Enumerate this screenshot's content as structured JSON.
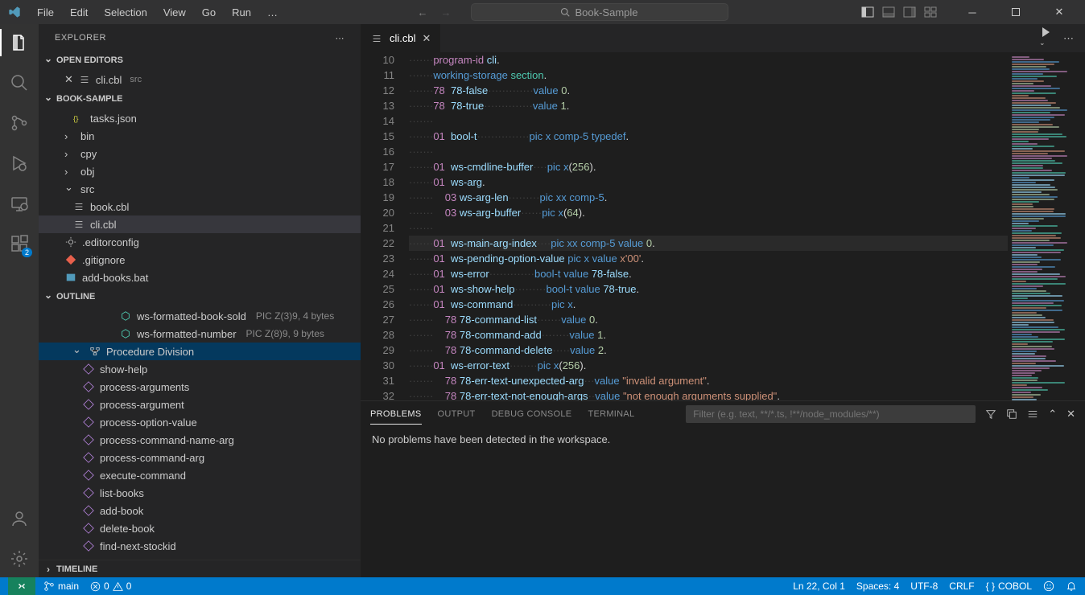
{
  "title": "Book-Sample",
  "menu": [
    "File",
    "Edit",
    "Selection",
    "View",
    "Go",
    "Run",
    "…"
  ],
  "explorer": {
    "title": "EXPLORER",
    "openEditors": {
      "label": "OPEN EDITORS",
      "items": [
        {
          "name": "cli.cbl",
          "dir": "src"
        }
      ]
    },
    "folder": {
      "label": "BOOK-SAMPLE",
      "items": [
        {
          "name": "tasks.json",
          "icon": "json",
          "indent": 2
        },
        {
          "name": "bin",
          "icon": "folder",
          "indent": 1,
          "chev": "r"
        },
        {
          "name": "cpy",
          "icon": "folder",
          "indent": 1,
          "chev": "r"
        },
        {
          "name": "obj",
          "icon": "folder",
          "indent": 1,
          "chev": "r"
        },
        {
          "name": "src",
          "icon": "folder",
          "indent": 1,
          "chev": "d"
        },
        {
          "name": "book.cbl",
          "icon": "cobol",
          "indent": 2
        },
        {
          "name": "cli.cbl",
          "icon": "cobol",
          "indent": 2,
          "active": true
        },
        {
          "name": ".editorconfig",
          "icon": "config",
          "indent": 1
        },
        {
          "name": ".gitignore",
          "icon": "git",
          "indent": 1
        },
        {
          "name": "add-books.bat",
          "icon": "bat",
          "indent": 1
        }
      ]
    },
    "outline": {
      "label": "OUTLINE",
      "items": [
        {
          "name": "ws-formatted-book-sold",
          "meta": "PIC Z(3)9, 4 bytes",
          "icon": "hex",
          "indent": 4
        },
        {
          "name": "ws-formatted-number",
          "meta": "PIC Z(8)9, 9 bytes",
          "icon": "hex",
          "indent": 4
        },
        {
          "name": "Procedure Division",
          "icon": "proc",
          "indent": 2,
          "chev": "d",
          "selected": true
        },
        {
          "name": "show-help",
          "icon": "func",
          "indent": 3
        },
        {
          "name": "process-arguments",
          "icon": "func",
          "indent": 3
        },
        {
          "name": "process-argument",
          "icon": "func",
          "indent": 3
        },
        {
          "name": "process-option-value",
          "icon": "func",
          "indent": 3
        },
        {
          "name": "process-command-name-arg",
          "icon": "func",
          "indent": 3
        },
        {
          "name": "process-command-arg",
          "icon": "func",
          "indent": 3
        },
        {
          "name": "execute-command",
          "icon": "func",
          "indent": 3
        },
        {
          "name": "list-books",
          "icon": "func",
          "indent": 3
        },
        {
          "name": "add-book",
          "icon": "func",
          "indent": 3
        },
        {
          "name": "delete-book",
          "icon": "func",
          "indent": 3
        },
        {
          "name": "find-next-stockid",
          "icon": "func",
          "indent": 3
        }
      ]
    },
    "timeline": "TIMELINE"
  },
  "tab": {
    "name": "cli.cbl"
  },
  "code": {
    "start": 10,
    "lines": [
      [
        [
          "lvl",
          "program-id"
        ],
        [
          "plain",
          " "
        ],
        [
          "id",
          "cli"
        ],
        [
          "plain",
          "."
        ]
      ],
      [
        [
          "kw",
          "working-storage"
        ],
        [
          "plain",
          " "
        ],
        [
          "sec",
          "section"
        ],
        [
          "plain",
          "."
        ]
      ],
      [
        [
          "lvl",
          "78"
        ],
        [
          "plain",
          "  "
        ],
        [
          "id",
          "78-false"
        ],
        [
          "dots",
          "·············"
        ],
        [
          "kw",
          "value"
        ],
        [
          "plain",
          " "
        ],
        [
          "num",
          "0"
        ],
        [
          "plain",
          "."
        ]
      ],
      [
        [
          "lvl",
          "78"
        ],
        [
          "plain",
          "  "
        ],
        [
          "id",
          "78-true"
        ],
        [
          "dots",
          "··············"
        ],
        [
          "kw",
          "value"
        ],
        [
          "plain",
          " "
        ],
        [
          "num",
          "1"
        ],
        [
          "plain",
          "."
        ]
      ],
      [],
      [
        [
          "lvl",
          "01"
        ],
        [
          "plain",
          "  "
        ],
        [
          "id",
          "bool-t"
        ],
        [
          "dots",
          "···············"
        ],
        [
          "kw",
          "pic"
        ],
        [
          "plain",
          " "
        ],
        [
          "type",
          "x"
        ],
        [
          "plain",
          " "
        ],
        [
          "kw",
          "comp-5"
        ],
        [
          "plain",
          " "
        ],
        [
          "kw",
          "typedef"
        ],
        [
          "plain",
          "."
        ]
      ],
      [],
      [
        [
          "lvl",
          "01"
        ],
        [
          "plain",
          "  "
        ],
        [
          "id",
          "ws-cmdline-buffer"
        ],
        [
          "dots",
          "····"
        ],
        [
          "kw",
          "pic"
        ],
        [
          "plain",
          " "
        ],
        [
          "type",
          "x"
        ],
        [
          "plain",
          "("
        ],
        [
          "num",
          "256"
        ],
        [
          "plain",
          ")."
        ]
      ],
      [
        [
          "lvl",
          "01"
        ],
        [
          "plain",
          "  "
        ],
        [
          "id",
          "ws-arg"
        ],
        [
          "plain",
          "."
        ]
      ],
      [
        [
          "plain",
          "    "
        ],
        [
          "lvl",
          "03"
        ],
        [
          "plain",
          " "
        ],
        [
          "id",
          "ws-arg-len"
        ],
        [
          "dots",
          "·········"
        ],
        [
          "kw",
          "pic"
        ],
        [
          "plain",
          " "
        ],
        [
          "type",
          "xx"
        ],
        [
          "plain",
          " "
        ],
        [
          "kw",
          "comp-5"
        ],
        [
          "plain",
          "."
        ]
      ],
      [
        [
          "plain",
          "    "
        ],
        [
          "lvl",
          "03"
        ],
        [
          "plain",
          " "
        ],
        [
          "id",
          "ws-arg-buffer"
        ],
        [
          "dots",
          "······"
        ],
        [
          "kw",
          "pic"
        ],
        [
          "plain",
          " "
        ],
        [
          "type",
          "x"
        ],
        [
          "plain",
          "("
        ],
        [
          "num",
          "64"
        ],
        [
          "plain",
          ")."
        ]
      ],
      [],
      [
        [
          "lvl",
          "01"
        ],
        [
          "plain",
          "  "
        ],
        [
          "id",
          "ws-main-arg-index"
        ],
        [
          "dots",
          "····"
        ],
        [
          "kw",
          "pic"
        ],
        [
          "plain",
          " "
        ],
        [
          "type",
          "xx"
        ],
        [
          "plain",
          " "
        ],
        [
          "kw",
          "comp-5"
        ],
        [
          "plain",
          " "
        ],
        [
          "kw",
          "value"
        ],
        [
          "plain",
          " "
        ],
        [
          "num",
          "0"
        ],
        [
          "plain",
          "."
        ]
      ],
      [
        [
          "lvl",
          "01"
        ],
        [
          "plain",
          "  "
        ],
        [
          "id",
          "ws-pending-option-value"
        ],
        [
          "plain",
          " "
        ],
        [
          "kw",
          "pic"
        ],
        [
          "plain",
          " "
        ],
        [
          "type",
          "x"
        ],
        [
          "plain",
          " "
        ],
        [
          "kw",
          "value"
        ],
        [
          "plain",
          " "
        ],
        [
          "str",
          "x'00'"
        ],
        [
          "plain",
          "."
        ]
      ],
      [
        [
          "lvl",
          "01"
        ],
        [
          "plain",
          "  "
        ],
        [
          "id",
          "ws-error"
        ],
        [
          "dots",
          "·············"
        ],
        [
          "type",
          "bool-t"
        ],
        [
          "plain",
          " "
        ],
        [
          "kw",
          "value"
        ],
        [
          "plain",
          " "
        ],
        [
          "id",
          "78-false"
        ],
        [
          "plain",
          "."
        ]
      ],
      [
        [
          "lvl",
          "01"
        ],
        [
          "plain",
          "  "
        ],
        [
          "id",
          "ws-show-help"
        ],
        [
          "dots",
          "·········"
        ],
        [
          "type",
          "bool-t"
        ],
        [
          "plain",
          " "
        ],
        [
          "kw",
          "value"
        ],
        [
          "plain",
          " "
        ],
        [
          "id",
          "78-true"
        ],
        [
          "plain",
          "."
        ]
      ],
      [
        [
          "lvl",
          "01"
        ],
        [
          "plain",
          "  "
        ],
        [
          "id",
          "ws-command"
        ],
        [
          "dots",
          "···········"
        ],
        [
          "kw",
          "pic"
        ],
        [
          "plain",
          " "
        ],
        [
          "type",
          "x"
        ],
        [
          "plain",
          "."
        ]
      ],
      [
        [
          "plain",
          "    "
        ],
        [
          "lvl",
          "78"
        ],
        [
          "plain",
          " "
        ],
        [
          "id",
          "78-command-list"
        ],
        [
          "dots",
          "·······"
        ],
        [
          "kw",
          "value"
        ],
        [
          "plain",
          " "
        ],
        [
          "num",
          "0"
        ],
        [
          "plain",
          "."
        ]
      ],
      [
        [
          "plain",
          "    "
        ],
        [
          "lvl",
          "78"
        ],
        [
          "plain",
          " "
        ],
        [
          "id",
          "78-command-add"
        ],
        [
          "dots",
          "········"
        ],
        [
          "kw",
          "value"
        ],
        [
          "plain",
          " "
        ],
        [
          "num",
          "1"
        ],
        [
          "plain",
          "."
        ]
      ],
      [
        [
          "plain",
          "    "
        ],
        [
          "lvl",
          "78"
        ],
        [
          "plain",
          " "
        ],
        [
          "id",
          "78-command-delete"
        ],
        [
          "dots",
          "·····"
        ],
        [
          "kw",
          "value"
        ],
        [
          "plain",
          " "
        ],
        [
          "num",
          "2"
        ],
        [
          "plain",
          "."
        ]
      ],
      [
        [
          "lvl",
          "01"
        ],
        [
          "plain",
          "  "
        ],
        [
          "id",
          "ws-error-text"
        ],
        [
          "dots",
          "········"
        ],
        [
          "kw",
          "pic"
        ],
        [
          "plain",
          " "
        ],
        [
          "type",
          "x"
        ],
        [
          "plain",
          "("
        ],
        [
          "num",
          "256"
        ],
        [
          "plain",
          ")."
        ]
      ],
      [
        [
          "plain",
          "    "
        ],
        [
          "lvl",
          "78"
        ],
        [
          "plain",
          " "
        ],
        [
          "id",
          "78-err-text-unexpected-arg"
        ],
        [
          "dots",
          "···"
        ],
        [
          "kw",
          "value"
        ],
        [
          "plain",
          " "
        ],
        [
          "str",
          "\"invalid argument\""
        ],
        [
          "plain",
          "."
        ]
      ],
      [
        [
          "plain",
          "    "
        ],
        [
          "lvl",
          "78"
        ],
        [
          "plain",
          " "
        ],
        [
          "id",
          "78-err-text-not-enough-args"
        ],
        [
          "dots",
          "··"
        ],
        [
          "kw",
          "value"
        ],
        [
          "plain",
          " "
        ],
        [
          "str",
          "\"not enough arguments supplied\""
        ],
        [
          "plain",
          "."
        ]
      ]
    ],
    "highlight": 22
  },
  "panel": {
    "tabs": [
      "PROBLEMS",
      "OUTPUT",
      "DEBUG CONSOLE",
      "TERMINAL"
    ],
    "active": 0,
    "filter_placeholder": "Filter (e.g. text, **/*.ts, !**/node_modules/**)",
    "message": "No problems have been detected in the workspace."
  },
  "status": {
    "branch": "main",
    "errors": "0",
    "warnings": "0",
    "position": "Ln 22, Col 1",
    "spaces": "Spaces: 4",
    "encoding": "UTF-8",
    "eol": "CRLF",
    "language": "COBOL"
  }
}
